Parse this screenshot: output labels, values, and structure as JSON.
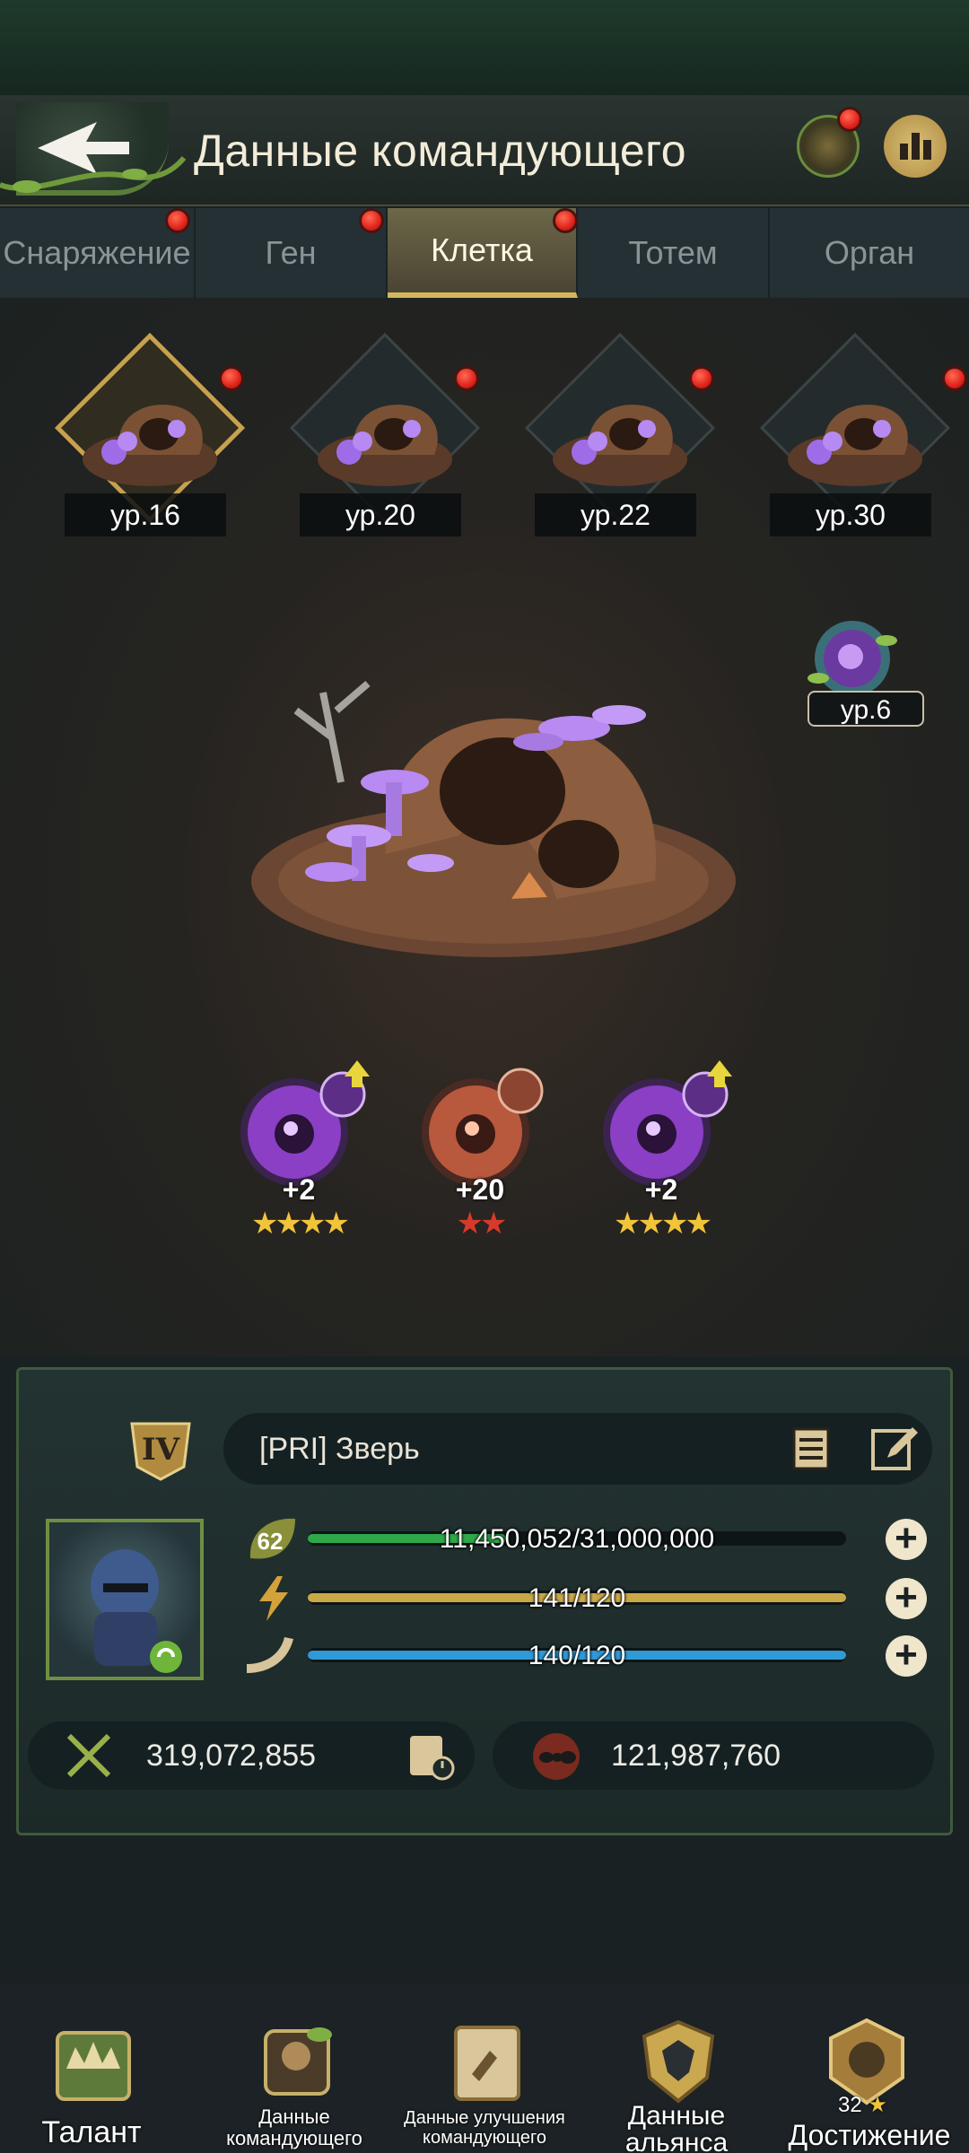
{
  "header": {
    "title": "Данные командующего",
    "back_icon": "back-arrow-icon",
    "beast_icon": "beast-head-icon",
    "rank_icon": "ranking-icon"
  },
  "tabs": [
    {
      "label": "Снаряжение",
      "badge": true,
      "active": false
    },
    {
      "label": "Ген",
      "badge": true,
      "active": false
    },
    {
      "label": "Клетка",
      "badge": true,
      "active": true
    },
    {
      "label": "Тотем",
      "badge": false,
      "active": false
    },
    {
      "label": "Орган",
      "badge": false,
      "active": false
    }
  ],
  "cage_slots": [
    {
      "level": "ур.16",
      "selected": true,
      "badge": true
    },
    {
      "level": "ур.20",
      "selected": false,
      "badge": true
    },
    {
      "level": "ур.22",
      "selected": false,
      "badge": true
    },
    {
      "level": "ур.30",
      "selected": false,
      "badge": true
    }
  ],
  "orb_badge": {
    "level": "ур.6",
    "icon": "purple-orb-icon"
  },
  "gems": [
    {
      "icon": "purple-gem-icon",
      "bonus": "+2",
      "stars": "★★★★",
      "star_color": "#f2c43a",
      "upgrade_arrow": true
    },
    {
      "icon": "red-gem-icon",
      "bonus": "+20",
      "stars": "★★",
      "star_color": "#d83a2a",
      "upgrade_arrow": false
    },
    {
      "icon": "purple-gem-icon",
      "bonus": "+2",
      "stars": "★★★★",
      "star_color": "#f2c43a",
      "upgrade_arrow": true
    }
  ],
  "commander": {
    "rank_badge": "IV",
    "name": "[PRI]  Зверь",
    "level": "62",
    "stats": [
      {
        "icon": "level-leaf-icon",
        "value": "11,450,052/31,000,000",
        "fraction": 0.369,
        "color": "#2fa84a"
      },
      {
        "icon": "lightning-icon",
        "value": "141/120",
        "fraction": 1.0,
        "color": "#c9a847"
      },
      {
        "icon": "horn-icon",
        "value": "140/120",
        "fraction": 1.0,
        "color": "#2f9ad6"
      }
    ],
    "power": "319,072,855",
    "kills": "121,987,760"
  },
  "bottom_nav": [
    {
      "label": "Талант",
      "icon": "talent-crown-icon"
    },
    {
      "label": "Данные командующего",
      "icon": "commander-data-icon"
    },
    {
      "label": "Данные улучшения командующего",
      "icon": "upgrade-scroll-icon"
    },
    {
      "label": "Данные альянса",
      "icon": "alliance-shield-icon"
    },
    {
      "label": "Достижение",
      "icon": "achievement-icon",
      "count": "32"
    }
  ],
  "colors": {
    "accent_gold": "#d3b75d",
    "badge_red": "#e0231a",
    "panel_green": "#3f5a3c"
  }
}
